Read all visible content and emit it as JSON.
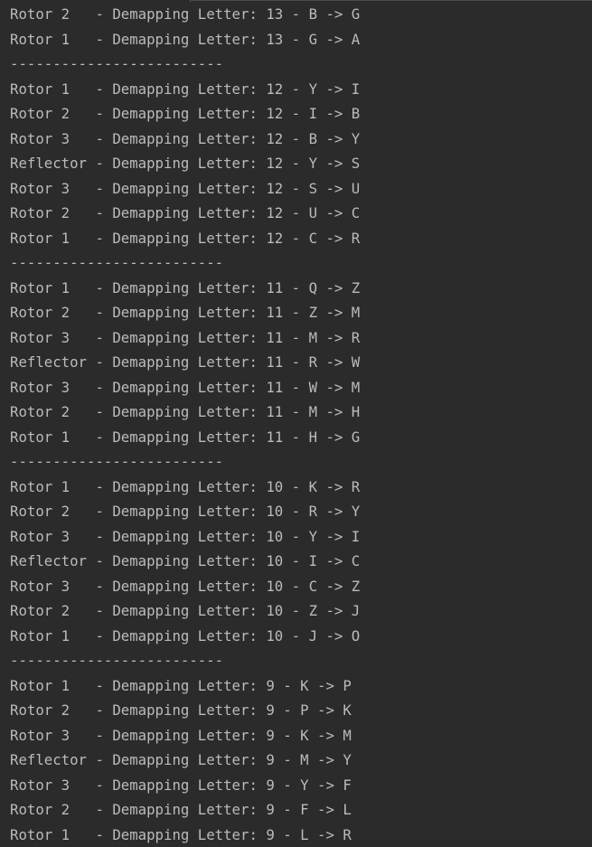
{
  "console": {
    "lines": [
      "Rotor 2   - Demapping Letter: 13 - B -> G",
      "Rotor 1   - Demapping Letter: 13 - G -> A",
      "-------------------------",
      "Rotor 1   - Demapping Letter: 12 - Y -> I",
      "Rotor 2   - Demapping Letter: 12 - I -> B",
      "Rotor 3   - Demapping Letter: 12 - B -> Y",
      "Reflector - Demapping Letter: 12 - Y -> S",
      "Rotor 3   - Demapping Letter: 12 - S -> U",
      "Rotor 2   - Demapping Letter: 12 - U -> C",
      "Rotor 1   - Demapping Letter: 12 - C -> R",
      "-------------------------",
      "Rotor 1   - Demapping Letter: 11 - Q -> Z",
      "Rotor 2   - Demapping Letter: 11 - Z -> M",
      "Rotor 3   - Demapping Letter: 11 - M -> R",
      "Reflector - Demapping Letter: 11 - R -> W",
      "Rotor 3   - Demapping Letter: 11 - W -> M",
      "Rotor 2   - Demapping Letter: 11 - M -> H",
      "Rotor 1   - Demapping Letter: 11 - H -> G",
      "-------------------------",
      "Rotor 1   - Demapping Letter: 10 - K -> R",
      "Rotor 2   - Demapping Letter: 10 - R -> Y",
      "Rotor 3   - Demapping Letter: 10 - Y -> I",
      "Reflector - Demapping Letter: 10 - I -> C",
      "Rotor 3   - Demapping Letter: 10 - C -> Z",
      "Rotor 2   - Demapping Letter: 10 - Z -> J",
      "Rotor 1   - Demapping Letter: 10 - J -> O",
      "-------------------------",
      "Rotor 1   - Demapping Letter: 9 - K -> P",
      "Rotor 2   - Demapping Letter: 9 - P -> K",
      "Rotor 3   - Demapping Letter: 9 - K -> M",
      "Reflector - Demapping Letter: 9 - M -> Y",
      "Rotor 3   - Demapping Letter: 9 - Y -> F",
      "Rotor 2   - Demapping Letter: 9 - F -> L",
      "Rotor 1   - Demapping Letter: 9 - L -> R"
    ]
  }
}
